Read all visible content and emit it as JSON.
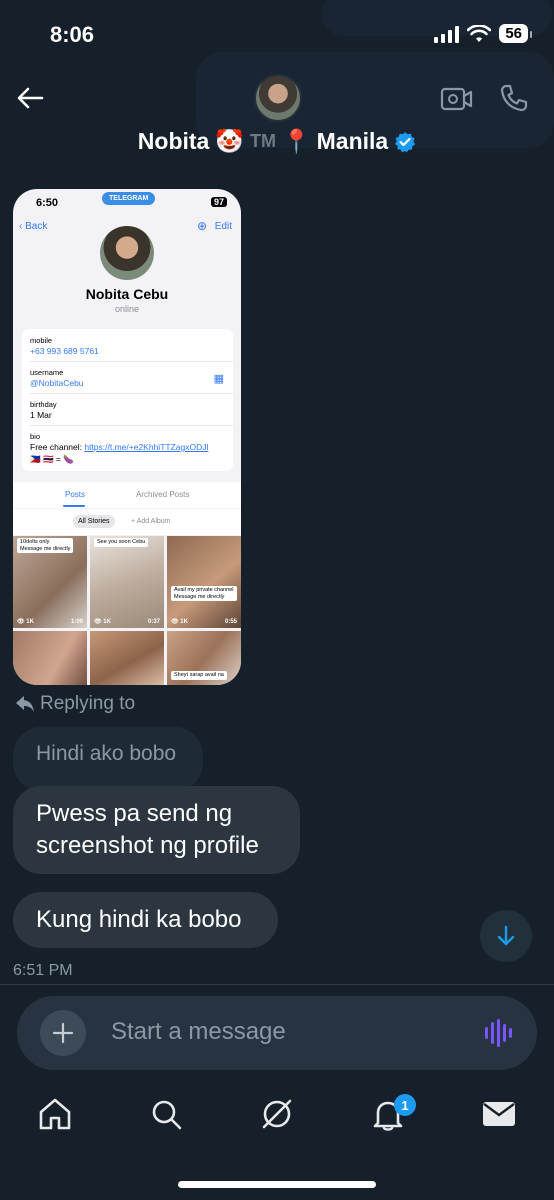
{
  "status_bar": {
    "time": "8:06",
    "battery": "56"
  },
  "header": {
    "name": "Nobita",
    "clown_emoji": "🤡",
    "tm": "TM",
    "pin_emoji": "📍",
    "location": "Manila"
  },
  "telegram_screenshot": {
    "time": "6:50",
    "app_pill": "TELEGRAM",
    "battery": "97",
    "back_label": "Back",
    "edit_label": "Edit",
    "profile_name": "Nobita Cebu",
    "status": "online",
    "fields": {
      "mobile_label": "mobile",
      "mobile_value": "+63 993 689 5761",
      "username_label": "username",
      "username_value": "@NobitaCebu",
      "birthday_label": "birthday",
      "birthday_value": "1 Mar",
      "bio_label": "bio",
      "bio_prefix": "Free channel:",
      "bio_link": "https://t.me/+e2KhhiTTZagxODJl",
      "bio_emojis": "🇵🇭 🇹🇭 = 🍆"
    },
    "tabs": {
      "posts": "Posts",
      "archived": "Archived Posts"
    },
    "stories_chip": "All Stories",
    "add_album": "+ Add Album",
    "thumbs": [
      {
        "caption": "10dolts only\nMessage me directly",
        "views": "1K",
        "duration": "1:00"
      },
      {
        "caption": "See you soon Cebu",
        "views": "1K",
        "duration": "0:37"
      },
      {
        "caption": "Avail my private channel\nMessage me directly",
        "views": "1K",
        "duration": "0:55"
      },
      {
        "caption": "",
        "views": "",
        "duration": ""
      },
      {
        "caption": "",
        "views": "",
        "duration": ""
      },
      {
        "caption": "Sheyt sarap avail na",
        "views": "",
        "duration": ""
      }
    ]
  },
  "replying_to": "Replying to",
  "messages": {
    "quoted": "Hindi ako bobo",
    "msg1": "Pwess pa send ng screenshot ng profile",
    "msg2": "Kung hindi ka bobo",
    "time": "6:51 PM"
  },
  "composer": {
    "placeholder": "Start a message"
  },
  "nav": {
    "notification_count": "1"
  },
  "colors": {
    "background": "#15202b",
    "bubble": "#2b3640",
    "accent": "#1d9bf0",
    "voice": "#7856ff"
  }
}
